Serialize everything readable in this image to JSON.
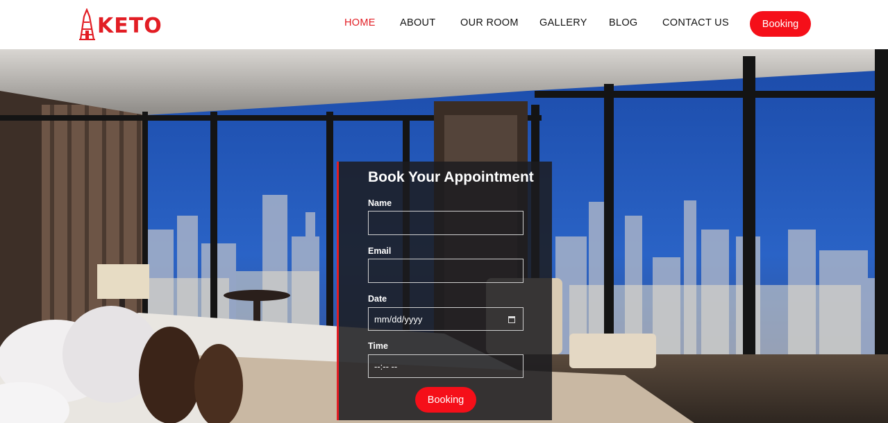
{
  "brand": {
    "name": "KETO",
    "logo_icon": "tower-icon",
    "accent_color": "#e21d24"
  },
  "nav": {
    "items": [
      {
        "label": "HOME",
        "active": true
      },
      {
        "label": "ABOUT",
        "active": false
      },
      {
        "label": "OUR ROOM",
        "active": false
      },
      {
        "label": "GALLERY",
        "active": false
      },
      {
        "label": "BLOG",
        "active": false
      },
      {
        "label": "CONTACT US",
        "active": false
      }
    ],
    "booking_label": "Booking"
  },
  "form": {
    "title": "Book Your Appointment",
    "name_label": "Name",
    "name_value": "",
    "email_label": "Email",
    "email_value": "",
    "date_label": "Date",
    "date_placeholder": "mm/dd/yyyy",
    "time_label": "Time",
    "time_placeholder": "--:-- --",
    "submit_label": "Booking"
  }
}
